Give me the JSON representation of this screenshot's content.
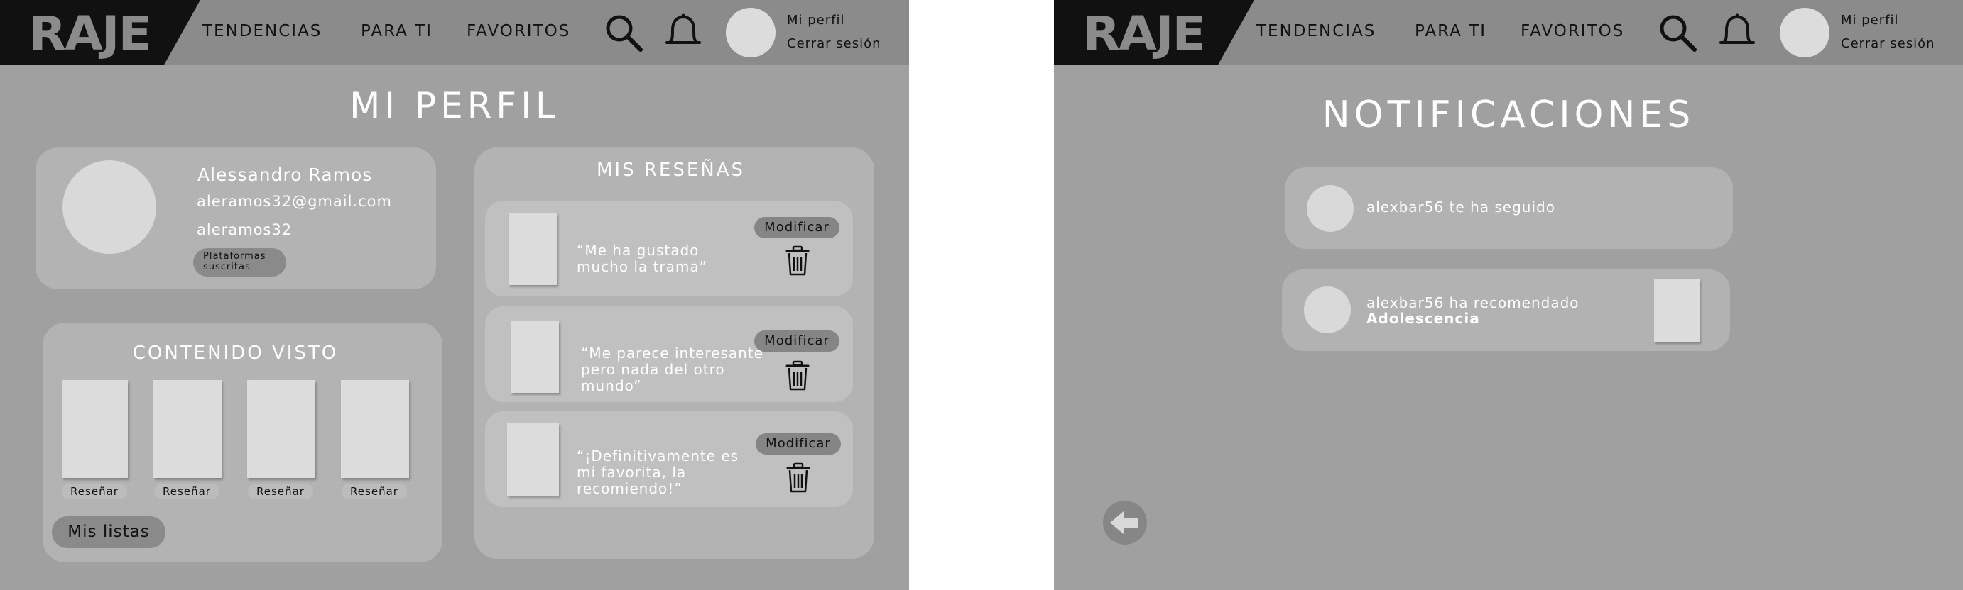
{
  "nav": {
    "logo": "RAJE",
    "links": [
      "TENDENCIAS",
      "PARA TI",
      "FAVORITOS"
    ],
    "user_links": {
      "profile": "Mi perfil",
      "logout": "Cerrar sesión"
    },
    "icons": [
      "search-icon",
      "bell-icon",
      "avatar"
    ]
  },
  "profile": {
    "title": "MI PERFIL",
    "user": {
      "name": "Alessandro Ramos",
      "email": "aleramos32@gmail.com",
      "username": "aleramos32",
      "platforms_button": "Plataformas suscritas"
    },
    "watched": {
      "heading": "CONTENIDO VISTO",
      "review_button": "Reseñar",
      "items_count": 4,
      "lists_button": "Mis listas"
    },
    "reviews": {
      "heading": "MIS RESEÑAS",
      "edit_button": "Modificar",
      "items": [
        "“Me ha gustado mucho la trama”",
        "“Me parece interesante pero nada del otro mundo”",
        "“¡Definitivamente es mi favorita, la recomiendo!”"
      ]
    }
  },
  "notifications": {
    "title": "NOTIFICACIONES",
    "items": [
      {
        "text": "alexbar56 te ha seguido",
        "bold": ""
      },
      {
        "text": "alexbar56 ha recomendado",
        "bold": "Adolescencia"
      }
    ]
  },
  "colors": {
    "background": "#a0a0a0",
    "navbar": "#8b8b8b",
    "logo_block": "#111111",
    "card": "#b3b3b3",
    "placeholder": "#dcdcdc"
  }
}
